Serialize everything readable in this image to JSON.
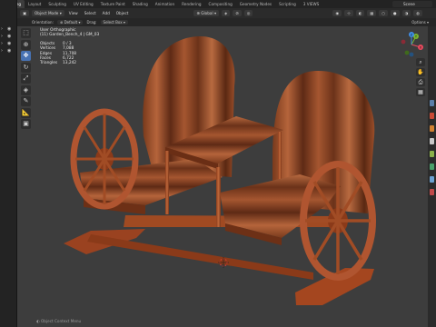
{
  "workspace_tabs": [
    "Modeling",
    "Layout",
    "Sculpting",
    "UV Editing",
    "Texture Paint",
    "Shading",
    "Animation",
    "Rendering",
    "Compositing",
    "Geometry Nodes",
    "Scripting",
    "3 VIEWS"
  ],
  "active_tab": "Modeling",
  "scene_name": "Scene",
  "header": {
    "mode": "Object Mode",
    "menus": [
      "View",
      "Select",
      "Add",
      "Object"
    ],
    "transform_orientation": "Global",
    "options_label": "Options"
  },
  "tool_settings": {
    "orientation_label": "Orientation:",
    "orientation_value": "Default",
    "drag_label": "Drag:",
    "drag_value": "Select Box"
  },
  "overlay": {
    "view_name": "User Orthographic",
    "collection": "(11) Garden_Bench_4 | GM_03",
    "stats": [
      {
        "label": "Objects",
        "value": "0 / 3"
      },
      {
        "label": "Vertices",
        "value": "7,088"
      },
      {
        "label": "Edges",
        "value": "11,708"
      },
      {
        "label": "Faces",
        "value": "6,722"
      },
      {
        "label": "Triangles",
        "value": "13,242"
      }
    ]
  },
  "gizmo": {
    "x": "X",
    "y": "Y",
    "z": "Z"
  },
  "status_hint": "Object Context Menu",
  "colors": {
    "viewport_bg": "#3d3d3d",
    "wood_light": "#b5643b",
    "wood_dark": "#5e2a15",
    "active_tool": "#4772b3",
    "axis_x": "#e84a5e",
    "axis_y": "#7ab52f",
    "axis_z": "#3f8ee6"
  }
}
